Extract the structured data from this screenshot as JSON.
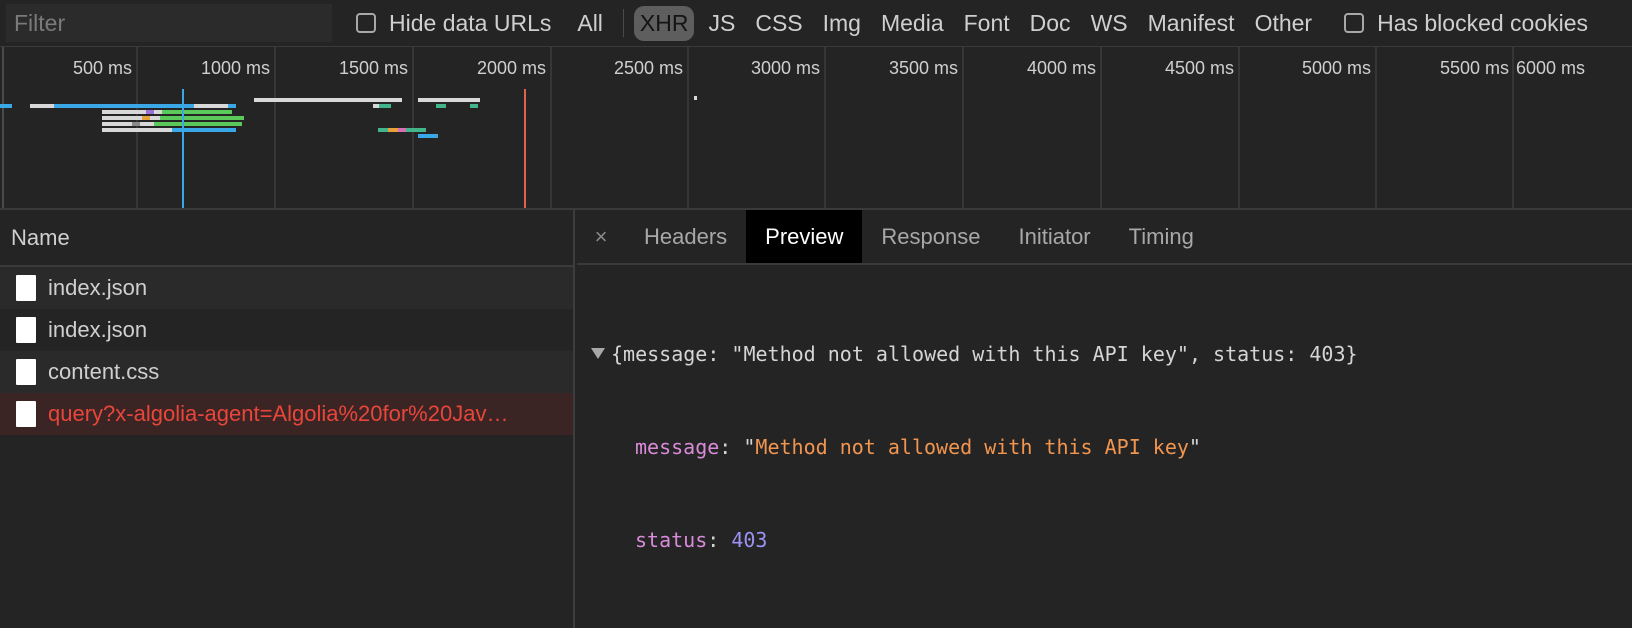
{
  "filter_bar": {
    "placeholder": "Filter",
    "hide_data_urls_label": "Hide data URLs",
    "types": [
      "All",
      "XHR",
      "JS",
      "CSS",
      "Img",
      "Media",
      "Font",
      "Doc",
      "WS",
      "Manifest",
      "Other"
    ],
    "active_type": "XHR",
    "blocked_cookies_label": "Has blocked cookies"
  },
  "overview": {
    "ticks": [
      "500 ms",
      "1000 ms",
      "1500 ms",
      "2000 ms",
      "2500 ms",
      "3000 ms",
      "3500 ms",
      "4000 ms",
      "4500 ms",
      "5000 ms",
      "5500 ms",
      "6000 ms"
    ],
    "dom_content_loaded_color": "#3aa7e6",
    "load_color": "#e2624f"
  },
  "requests": {
    "header": "Name",
    "rows": [
      {
        "name": "index.json",
        "status": "ok"
      },
      {
        "name": "index.json",
        "status": "ok"
      },
      {
        "name": "content.css",
        "status": "ok"
      },
      {
        "name": "query?x-algolia-agent=Algolia%20for%20Jav…",
        "status": "error"
      }
    ]
  },
  "details": {
    "close_label": "×",
    "tabs": [
      "Headers",
      "Preview",
      "Response",
      "Initiator",
      "Timing"
    ],
    "active_tab": "Preview",
    "preview": {
      "summary": "{message: \"Method not allowed with this API key\", status: 403}",
      "message_key": "message",
      "message_value": "Method not allowed with this API key",
      "status_key": "status",
      "status_value": "403"
    }
  },
  "colors": {
    "error_text": "#e9463b",
    "json_key": "#d98bd9",
    "json_string": "#f2954f",
    "json_number": "#9b92f3"
  }
}
